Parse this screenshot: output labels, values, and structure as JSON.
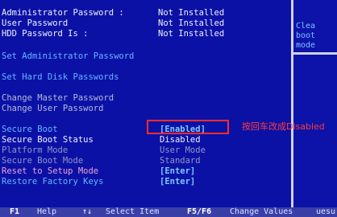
{
  "passwords": {
    "admin_label": "Administrator Password :",
    "admin_value": "Not Installed",
    "user_label": "User Password",
    "user_value": "Not Installed",
    "hdd_label": "HDD Password Is :",
    "hdd_value": "Not Installed"
  },
  "menu": {
    "set_admin": "Set Administrator Password",
    "set_hdd": "Set Hard Disk Passwords",
    "change_master": "Change Master Password",
    "change_user": "Change User Password"
  },
  "secure_boot": {
    "secure_boot_label": "Secure Boot",
    "secure_boot_value": "[Enabled]",
    "status_label": "Secure Boot Status",
    "status_value": "Disabled",
    "platform_label": "Platform Mode",
    "platform_value": "User Mode",
    "sb_mode_label": "Secure Boot Mode",
    "sb_mode_value": "Standard",
    "reset_label": "Reset to Setup Mode",
    "reset_value": "[Enter]",
    "restore_label": "Restore Factory Keys",
    "restore_value": "[Enter]"
  },
  "help": {
    "line1": "Clea",
    "line2": "boot",
    "line3": "mode"
  },
  "annotation": {
    "text": "按回车改成Disabled",
    "color": "#ff2c2c"
  },
  "footer": {
    "f1_key": "F1",
    "f1_desc": "Help",
    "arrows_key": "↑↓",
    "arrows_desc": "Select Item",
    "f5f6_key": "F5/F6",
    "f5f6_desc": "Change Values",
    "partial": "uesu"
  },
  "colors": {
    "background": "#0c11a6",
    "highlight": "#7ec8ff",
    "footer": "#3a3fa8"
  }
}
